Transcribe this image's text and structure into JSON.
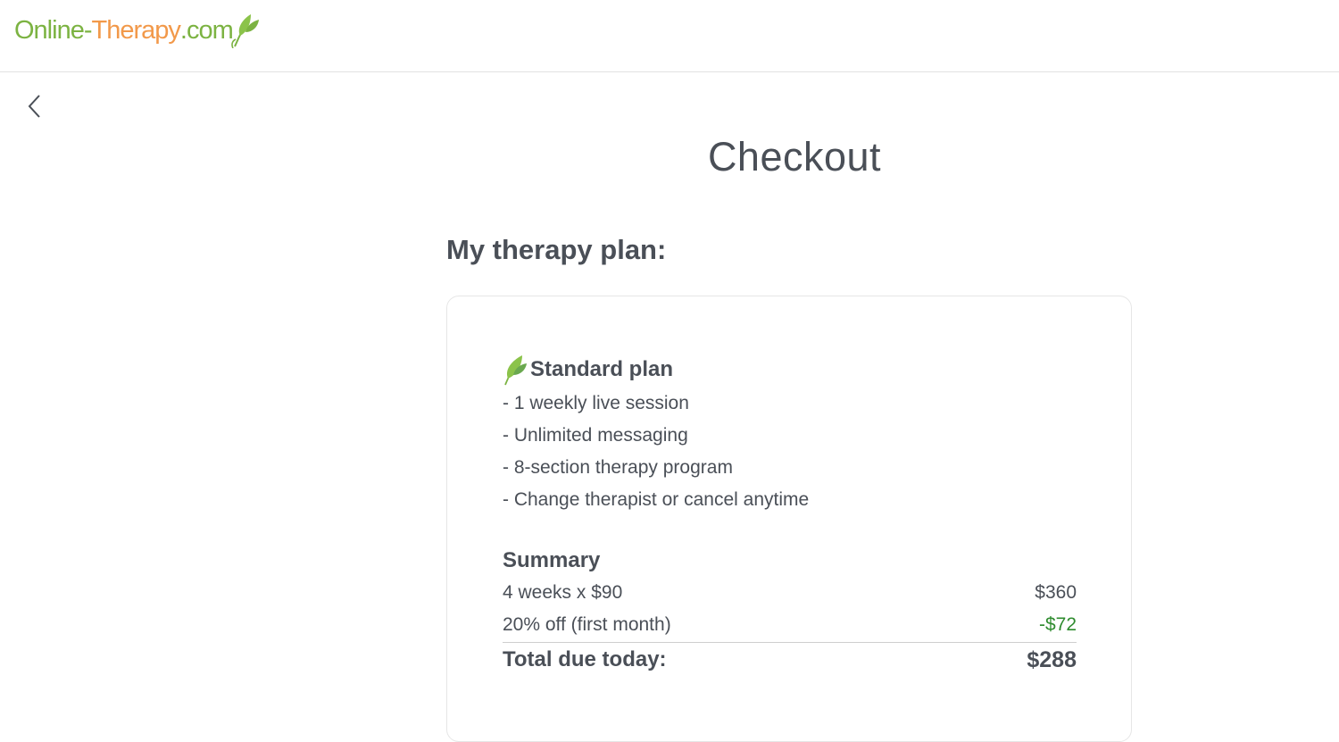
{
  "header": {
    "logo_part_1": "Online-",
    "logo_part_2": "Therapy",
    "logo_part_3": ".com",
    "logo_icon": "leaf-icon"
  },
  "nav": {
    "back_icon": "chevron-left-icon"
  },
  "page": {
    "title": "Checkout"
  },
  "plan_section": {
    "heading": "My therapy plan:",
    "plan_icon": "leaf-icon",
    "plan_name": "Standard plan",
    "features": [
      "- 1 weekly live session",
      "- Unlimited messaging",
      "- 8-section therapy program",
      "- Change therapist or cancel anytime"
    ]
  },
  "summary": {
    "title": "Summary",
    "rows": [
      {
        "label": "4 weeks x $90",
        "value": "$360"
      },
      {
        "label": "20% off (first month)",
        "value": "-$72"
      }
    ],
    "total_label": "Total due today:",
    "total_value": "$288"
  },
  "colors": {
    "logo_green": "#7cb342",
    "logo_orange": "#f2994a",
    "text": "#4a4f57",
    "discount_green": "#2e8b2e",
    "card_border": "#e6e6e6"
  }
}
